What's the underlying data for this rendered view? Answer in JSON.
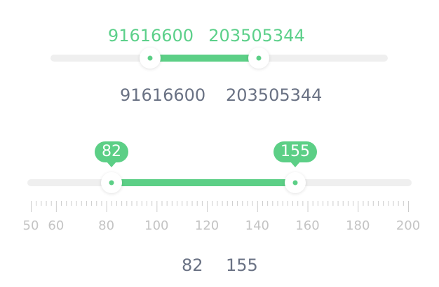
{
  "slider1": {
    "min": 0,
    "max": 325000000,
    "low": 91616600,
    "high": 203505344,
    "low_text": "91616600",
    "high_text": "203505344",
    "accent": "#5ccf86",
    "value_color": "#5cd08a"
  },
  "output1": {
    "low_text": "91616600",
    "high_text": "203505344",
    "color": "#6a7284"
  },
  "slider2": {
    "min": 50,
    "max": 200,
    "low": 82,
    "high": 155,
    "low_text": "82",
    "high_text": "155",
    "accent": "#5ccf86",
    "scale_labels": [
      "50",
      "60",
      "80",
      "100",
      "120",
      "140",
      "160",
      "180",
      "200"
    ],
    "scale_values": [
      50,
      60,
      80,
      100,
      120,
      140,
      160,
      180,
      200
    ],
    "tick_step": 2,
    "tick_color": "#cdcdcd",
    "label_color": "#c4c4c4"
  },
  "output2": {
    "low_text": "82",
    "high_text": "155",
    "color": "#6a7284"
  }
}
